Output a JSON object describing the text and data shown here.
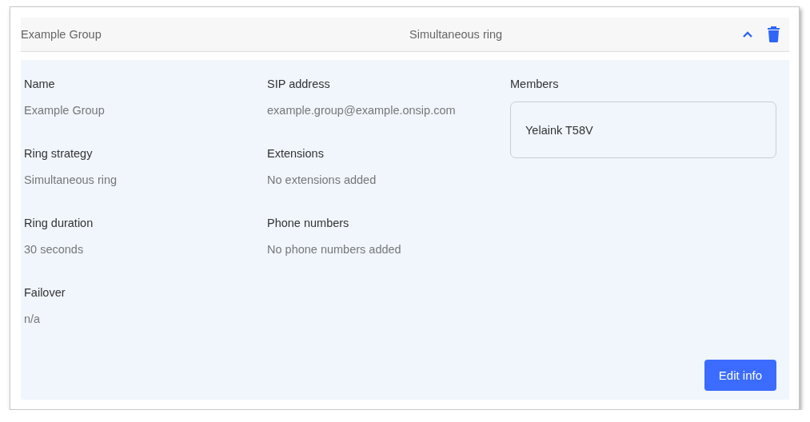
{
  "group": {
    "name": "Example Group",
    "strategy": "Simultaneous ring",
    "expanded": true
  },
  "columns": [
    [
      {
        "label": "Name",
        "value": "Example Group"
      },
      {
        "label": "Ring strategy",
        "value": "Simultaneous ring"
      },
      {
        "label": "Ring duration",
        "value": "30 seconds"
      },
      {
        "label": "Failover",
        "value": "n/a"
      }
    ],
    [
      {
        "label": "SIP address",
        "value": "example.group@example.onsip.com"
      },
      {
        "label": "Extensions",
        "value": "No extensions added"
      },
      {
        "label": "Phone numbers",
        "value": "No phone numbers added"
      }
    ]
  ],
  "members": {
    "label": "Members",
    "items": [
      "Yelaink T58V"
    ]
  },
  "buttons": [
    "Edit info"
  ]
}
